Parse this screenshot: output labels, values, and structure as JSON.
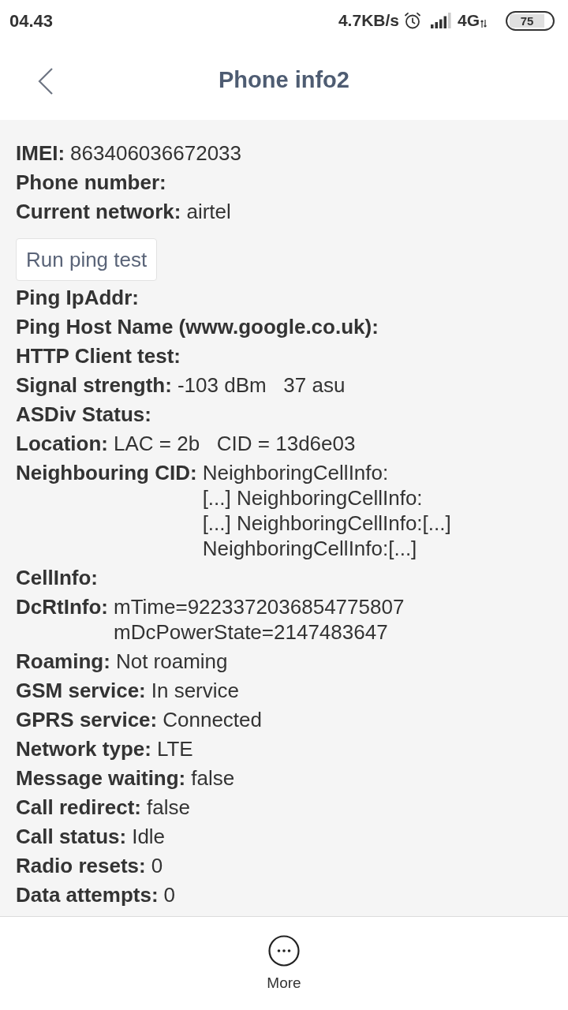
{
  "status_bar": {
    "time": "04.43",
    "net_speed": "4.7KB/s",
    "network_type": "4G",
    "battery": "75"
  },
  "header": {
    "title": "Phone info2"
  },
  "items": [
    {
      "kind": "field",
      "label": "IMEI:",
      "value": "863406036672033"
    },
    {
      "kind": "field",
      "label": "Phone number:"
    },
    {
      "kind": "field",
      "label": "Current network:",
      "value": "airtel"
    },
    {
      "kind": "button",
      "label": "Run ping test"
    },
    {
      "kind": "field",
      "label": "Ping IpAddr:"
    },
    {
      "kind": "field",
      "label": "Ping Host Name (www.google.co.uk):"
    },
    {
      "kind": "field",
      "label": "HTTP Client test:"
    },
    {
      "kind": "field",
      "label": "Signal strength:",
      "value": "-103 dBm   37 asu"
    },
    {
      "kind": "field",
      "label": "ASDiv Status:"
    },
    {
      "kind": "field",
      "label": "Location:",
      "value": "LAC = 2b   CID = 13d6e03"
    },
    {
      "kind": "field",
      "label": "Neighbouring CID:",
      "lines": [
        "NeighboringCellInfo:",
        "[...] NeighboringCellInfo:",
        "[...] NeighboringCellInfo:[...]",
        "NeighboringCellInfo:[...]"
      ]
    },
    {
      "kind": "field",
      "label": "CellInfo:"
    },
    {
      "kind": "field",
      "label": "DcRtInfo:",
      "lines": [
        "mTime=9223372036854775807",
        "mDcPowerState=2147483647"
      ]
    },
    {
      "kind": "field",
      "label": "Roaming:",
      "value": "Not roaming"
    },
    {
      "kind": "field",
      "label": "GSM service:",
      "value": "In service"
    },
    {
      "kind": "field",
      "label": "GPRS service:",
      "value": "Connected"
    },
    {
      "kind": "field",
      "label": "Network type:",
      "value": "LTE"
    },
    {
      "kind": "field",
      "label": "Message waiting:",
      "value": "false"
    },
    {
      "kind": "field",
      "label": "Call redirect:",
      "value": "false"
    },
    {
      "kind": "field",
      "label": "Call status:",
      "value": "Idle"
    },
    {
      "kind": "field",
      "label": "Radio resets:",
      "value": "0"
    },
    {
      "kind": "field",
      "label": "Data attempts:",
      "value": "0"
    }
  ],
  "bottom_bar": {
    "actions": [
      {
        "label": "More"
      }
    ]
  }
}
